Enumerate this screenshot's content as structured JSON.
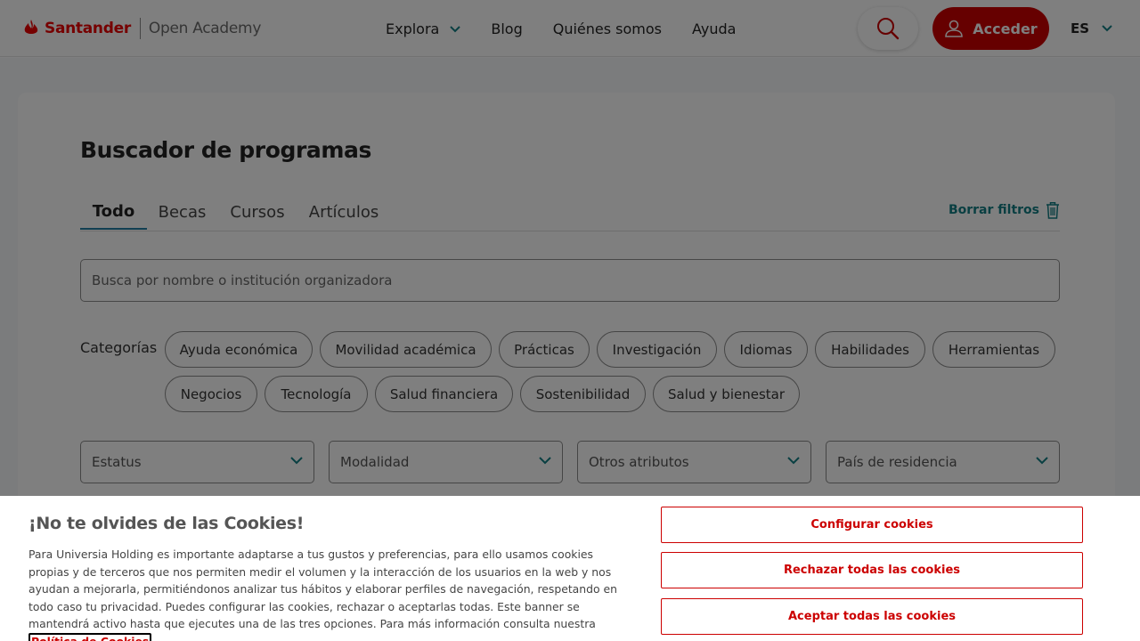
{
  "header": {
    "brand": "Santander",
    "product": "Open Academy",
    "nav": {
      "explora": "Explora",
      "blog": "Blog",
      "quienes": "Quiénes somos",
      "ayuda": "Ayuda"
    },
    "login_label": "Acceder",
    "language": "ES"
  },
  "main": {
    "title": "Buscador de programas",
    "tabs": [
      "Todo",
      "Becas",
      "Cursos",
      "Artículos"
    ],
    "active_tab": "Todo",
    "clear_filters": "Borrar filtros",
    "search_placeholder": "Busca por nombre o institución organizadora",
    "categories_label": "Categorías",
    "categories": [
      "Ayuda económica",
      "Movilidad académica",
      "Prácticas",
      "Investigación",
      "Idiomas",
      "Habilidades",
      "Herramientas",
      "Negocios",
      "Tecnología",
      "Salud financiera",
      "Sostenibilidad",
      "Salud y bienestar"
    ],
    "filters": [
      "Estatus",
      "Modalidad",
      "Otros atributos",
      "País de residencia"
    ]
  },
  "cookie_banner": {
    "title": "¡No te olvides de las Cookies!",
    "text": "Para Universia Holding es importante adaptarse a tus gustos y preferencias, para ello usamos cookies propias y de terceros que nos permiten medir el volumen y la interacción de los usuarios en la web y nos ayudan a mejorarla, permitiéndonos analizar tus hábitos y elaborar perfiles de navegación, respetando en todo caso tu privacidad. Puedes configurar las cookies, rechazar o aceptarlas todas. Este banner se mantendrá activo hasta que ejecutes una de las tres opciones. Para más información consulta nuestra",
    "link": "Política de Cookies",
    "buttons": {
      "configure": "Configurar cookies",
      "reject": "Rechazar todas las cookies",
      "accept": "Aceptar todas las cookies"
    }
  },
  "colors": {
    "brand_red": "#ec0000",
    "button_red": "#cc0000",
    "accent_teal": "#137e84",
    "tab_underline": "#257fa4"
  }
}
